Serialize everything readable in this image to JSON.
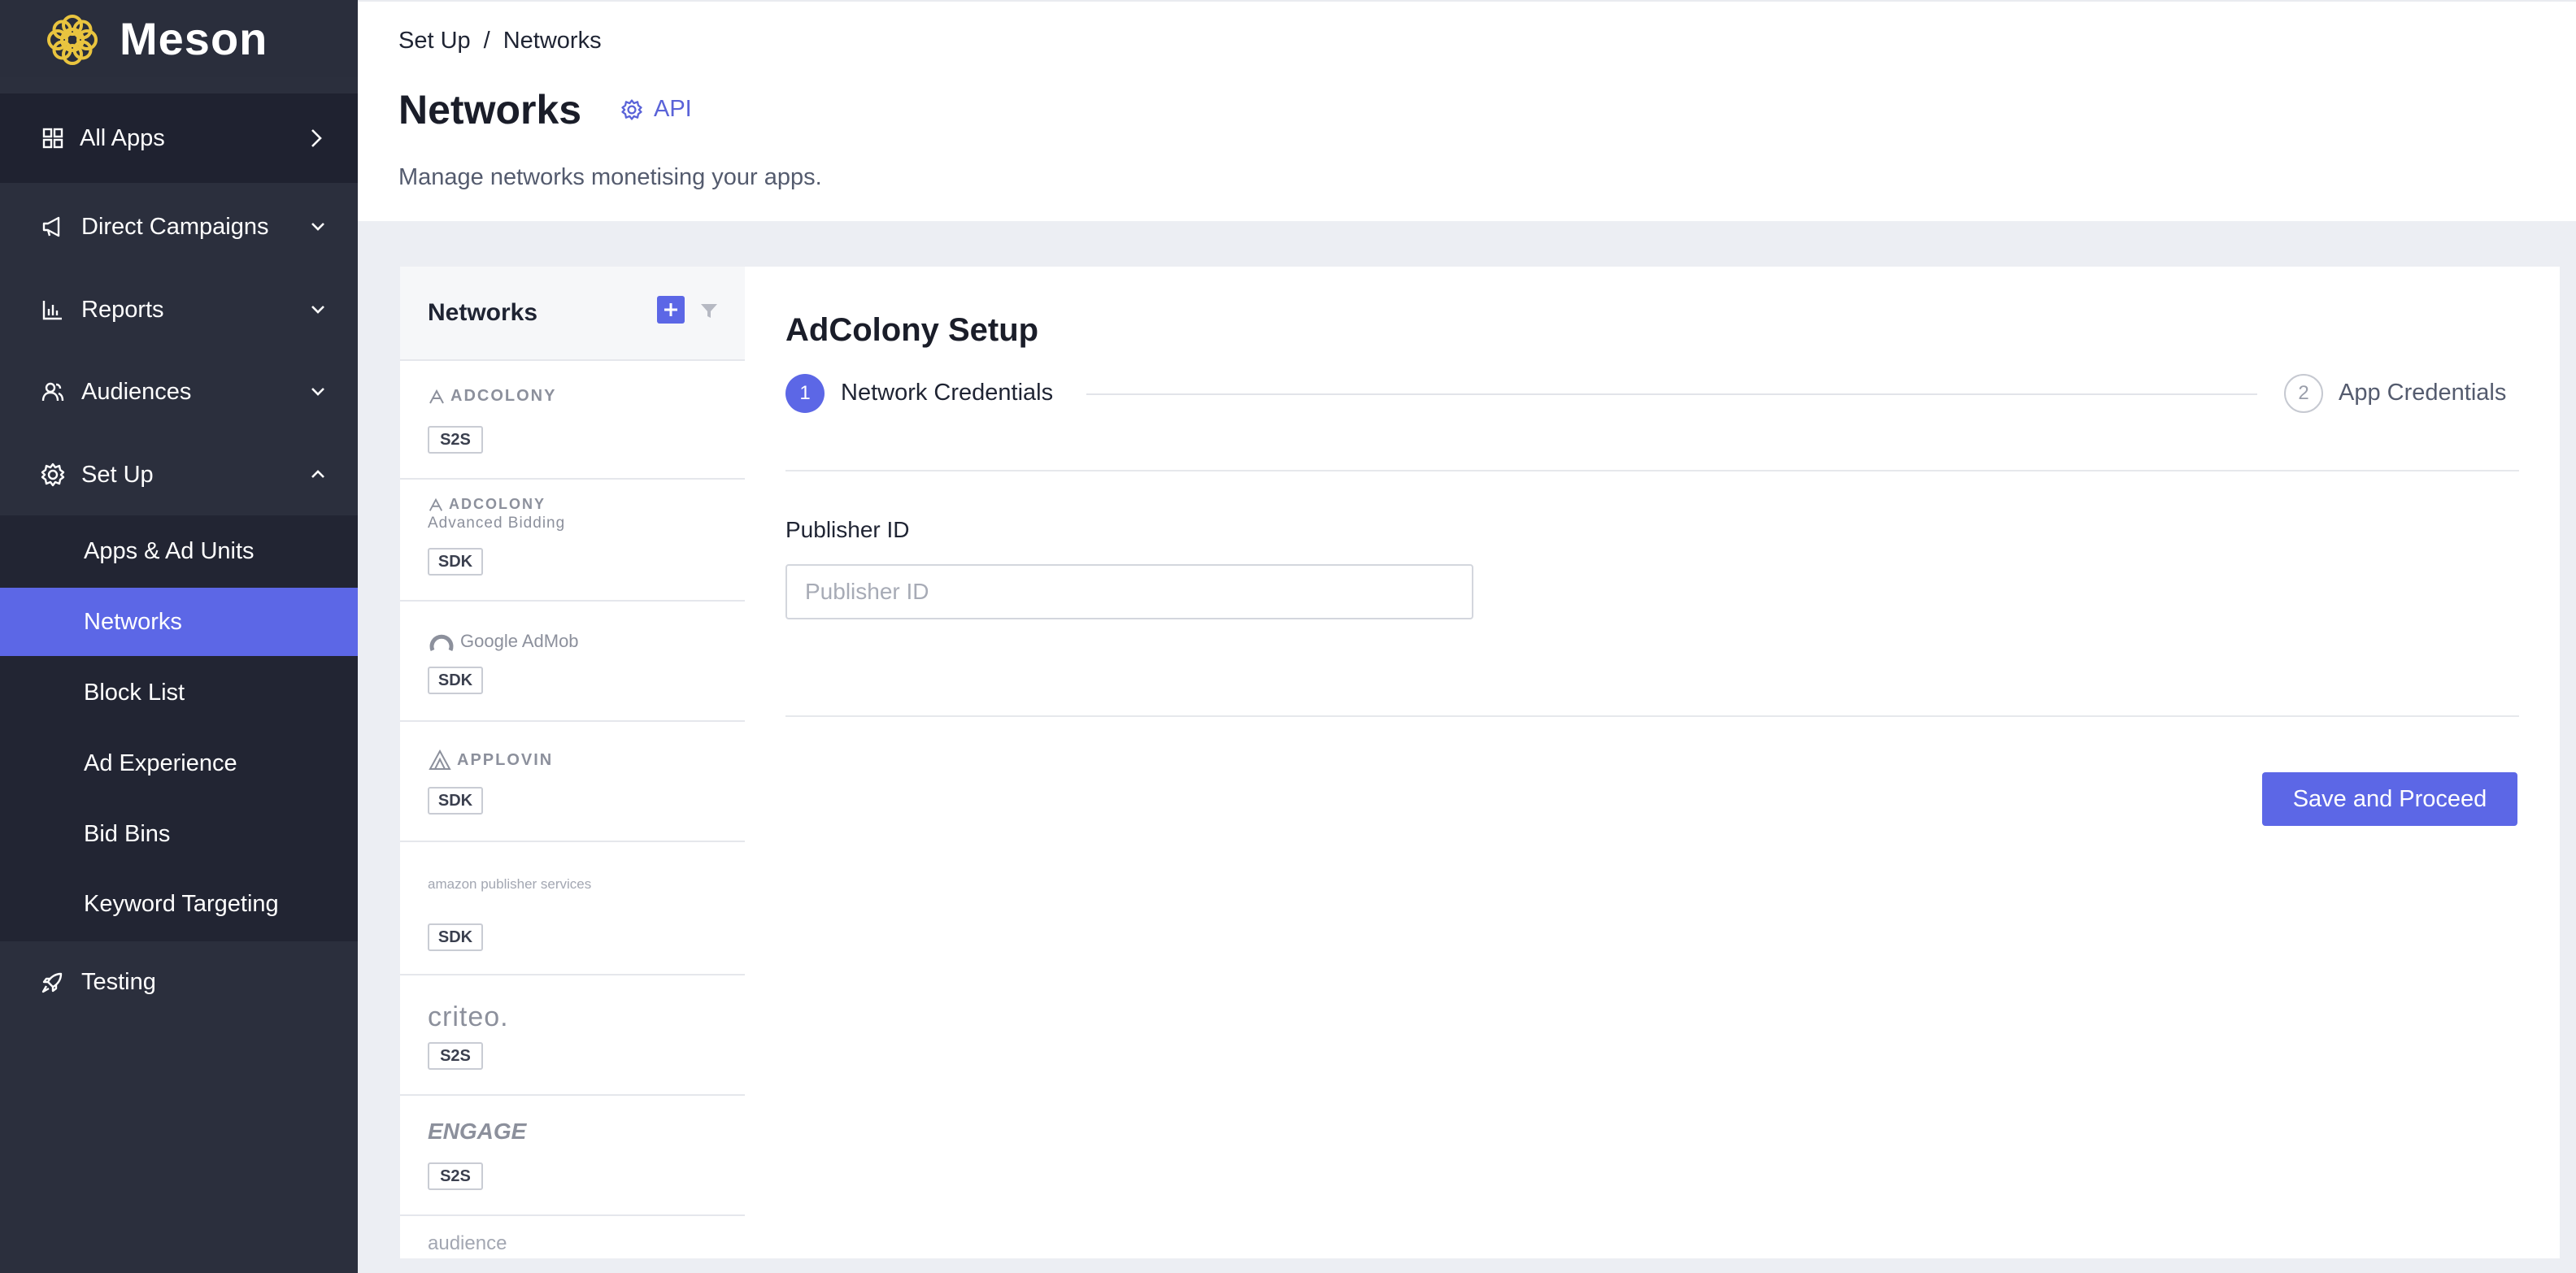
{
  "brand": {
    "name": "Meson",
    "logo_icon": "flower-logo",
    "accent": "#e9c43f"
  },
  "sidebar": {
    "all_apps": {
      "label": "All Apps",
      "icon": "grid-icon"
    },
    "items": [
      {
        "label": "Direct Campaigns",
        "icon": "megaphone-icon",
        "state": "collapsed"
      },
      {
        "label": "Reports",
        "icon": "bar-chart-icon",
        "state": "collapsed"
      },
      {
        "label": "Audiences",
        "icon": "users-icon",
        "state": "collapsed"
      },
      {
        "label": "Set Up",
        "icon": "gear-icon",
        "state": "expanded"
      }
    ],
    "setup_sub": [
      {
        "label": "Apps & Ad Units"
      },
      {
        "label": "Networks",
        "active": true
      },
      {
        "label": "Block List"
      },
      {
        "label": "Ad Experience"
      },
      {
        "label": "Bid Bins"
      },
      {
        "label": "Keyword Targeting"
      }
    ],
    "testing": {
      "label": "Testing",
      "icon": "rocket-icon"
    }
  },
  "header": {
    "breadcrumb": [
      "Set Up",
      "Networks"
    ],
    "breadcrumb_sep": "/",
    "title": "Networks",
    "api_label": "API",
    "subtitle": "Manage networks monetising your apps."
  },
  "networks_panel": {
    "title": "Networks",
    "rows": [
      {
        "logo": "ADCOLONY",
        "badge": "S2S"
      },
      {
        "logo": "ADCOLONY",
        "logo_sub": "Advanced Bidding",
        "badge": "SDK"
      },
      {
        "logo": "Google AdMob",
        "badge": "SDK"
      },
      {
        "logo": "APPLOVIN",
        "badge": "SDK"
      },
      {
        "logo": "amazon publisher services",
        "badge": "SDK"
      },
      {
        "logo": "criteo.",
        "badge": "S2S"
      },
      {
        "logo": "ENGAGE",
        "badge": "S2S"
      },
      {
        "logo": "audience"
      }
    ]
  },
  "setup": {
    "title": "AdColony Setup",
    "steps": [
      {
        "num": "1",
        "label": "Network Credentials",
        "active": true
      },
      {
        "num": "2",
        "label": "App Credentials",
        "active": false
      }
    ],
    "field_label": "Publisher ID",
    "field_placeholder": "Publisher ID",
    "field_value": "",
    "save_label": "Save and Proceed"
  },
  "colors": {
    "sidebar_bg": "#2b2f3d",
    "primary": "#5c67e6",
    "content_bg": "#eceef3"
  }
}
